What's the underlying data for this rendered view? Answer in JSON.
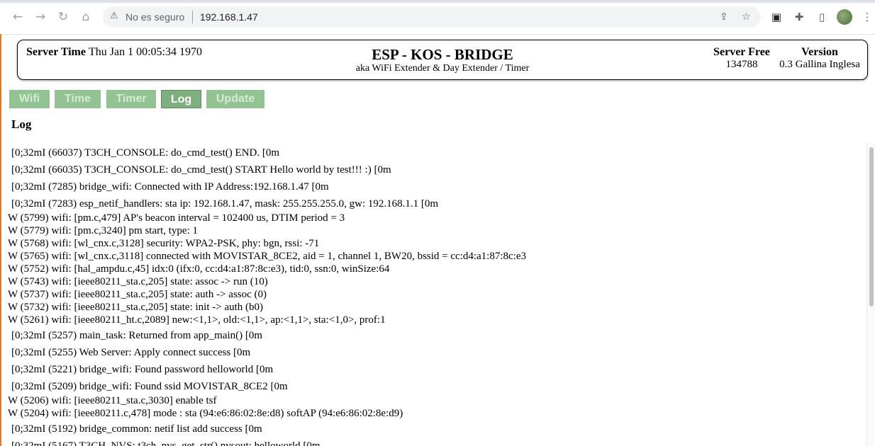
{
  "browser": {
    "security_label": "No es seguro",
    "url": "192.168.1.47"
  },
  "header": {
    "server_time_label": "Server Time",
    "server_time_value": "Thu Jan 1 00:05:34 1970",
    "title": "ESP - KOS - BRIDGE",
    "subtitle": "aka WiFi Extender & Day Extender / Timer",
    "server_free_label": "Server Free",
    "server_free_value": "134788",
    "version_label": "Version",
    "version_value": "0.3 Gallina Inglesa"
  },
  "tabs": [
    {
      "label": "Wifi",
      "active": false
    },
    {
      "label": "Time",
      "active": false
    },
    {
      "label": "Timer",
      "active": false
    },
    {
      "label": "Log",
      "active": true
    },
    {
      "label": "Update",
      "active": false
    }
  ],
  "section_title": "Log",
  "log_lines": [
    {
      "type": "info",
      "text": "[0;32mI (66037) T3CH_CONSOLE: do_cmd_test() END. [0m"
    },
    {
      "type": "info",
      "text": "[0;32mI (66035) T3CH_CONSOLE: do_cmd_test() START Hello world by test!!! :)  [0m"
    },
    {
      "type": "info",
      "text": "[0;32mI (7285) bridge_wifi: Connected with IP Address:192.168.1.47 [0m"
    },
    {
      "type": "info",
      "text": "[0;32mI (7283) esp_netif_handlers: sta ip: 192.168.1.47, mask: 255.255.255.0, gw: 192.168.1.1 [0m"
    },
    {
      "type": "warn",
      "text": "W (5799) wifi: [pm.c,479] AP's beacon interval = 102400 us, DTIM period = 3"
    },
    {
      "type": "warn",
      "text": "W (5779) wifi: [pm.c,3240] pm start, type: 1"
    },
    {
      "type": "warn",
      "text": "W (5768) wifi: [wl_cnx.c,3128] security: WPA2-PSK, phy: bgn, rssi: -71"
    },
    {
      "type": "warn",
      "text": "W (5765) wifi: [wl_cnx.c,3118] connected with MOVISTAR_8CE2, aid = 1, channel 1, BW20, bssid = cc:d4:a1:87:8c:e3"
    },
    {
      "type": "warn",
      "text": "W (5752) wifi: [hal_ampdu.c,45] idx:0 (ifx:0, cc:d4:a1:87:8c:e3), tid:0, ssn:0, winSize:64"
    },
    {
      "type": "warn",
      "text": "W (5743) wifi: [ieee80211_sta.c,205] state: assoc -> run (10)"
    },
    {
      "type": "warn",
      "text": "W (5737) wifi: [ieee80211_sta.c,205] state: auth -> assoc (0)"
    },
    {
      "type": "warn",
      "text": "W (5732) wifi: [ieee80211_sta.c,205] state: init -> auth (b0)"
    },
    {
      "type": "warn",
      "text": "W (5261) wifi: [ieee80211_ht.c,2089] new:<1,1>, old:<1,1>, ap:<1,1>, sta:<1,0>, prof:1"
    },
    {
      "type": "info",
      "text": "[0;32mI (5257) main_task: Returned from app_main() [0m"
    },
    {
      "type": "info",
      "text": "[0;32mI (5255) Web Server: Apply connect success [0m"
    },
    {
      "type": "info",
      "text": "[0;32mI (5221) bridge_wifi: Found password helloworld [0m"
    },
    {
      "type": "info",
      "text": "[0;32mI (5209) bridge_wifi: Found ssid MOVISTAR_8CE2 [0m"
    },
    {
      "type": "warn",
      "text": "W (5206) wifi: [ieee80211_sta.c,3030] enable tsf"
    },
    {
      "type": "warn",
      "text": "W (5204) wifi: [ieee80211.c,478] mode : sta (94:e6:86:02:8e:d8) softAP (94:e6:86:02:8e:d9)"
    },
    {
      "type": "info",
      "text": "[0;32mI (5192) bridge_common: netif list add success [0m"
    },
    {
      "type": "info",
      "text": "[0;32mI (5167) T3CH_NVS: t3ch_nvs_get_str() nvsout: helloworld [0m"
    }
  ]
}
